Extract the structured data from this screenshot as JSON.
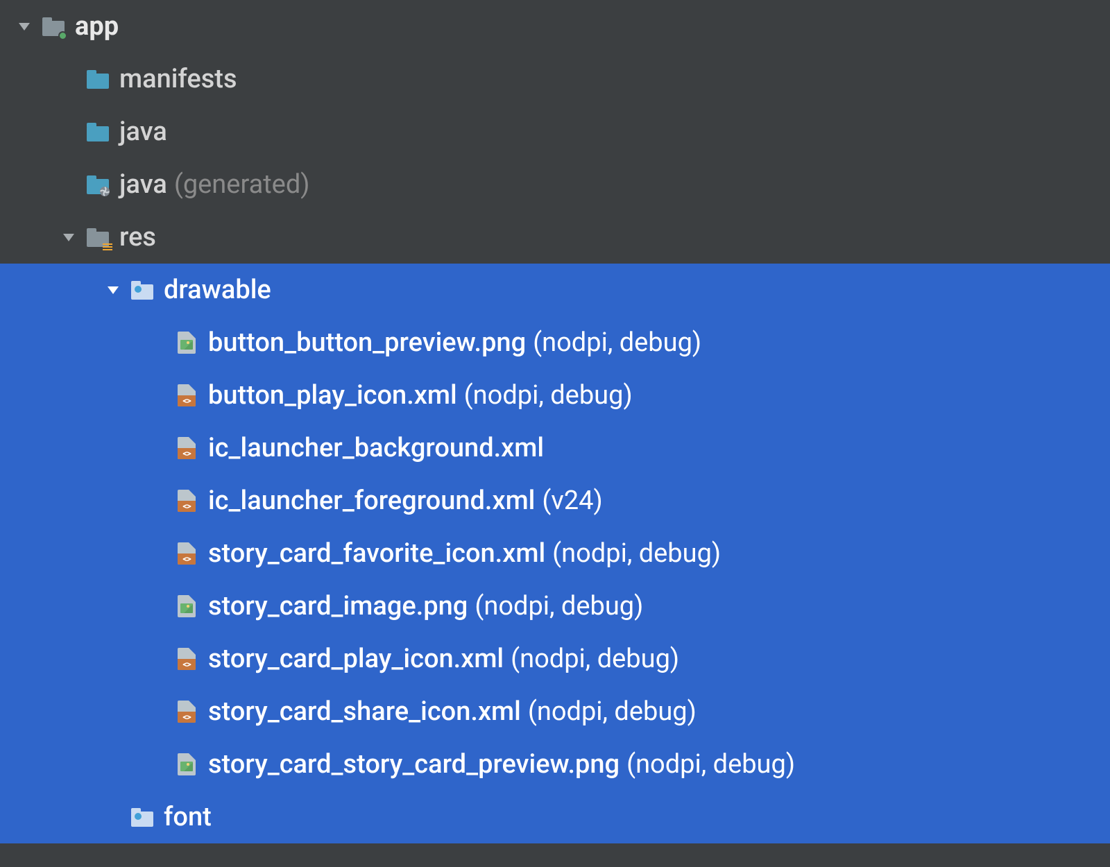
{
  "tree": {
    "root": {
      "name": "app",
      "expanded": true,
      "icon": "module-folder",
      "children": [
        {
          "name": "manifests",
          "expanded": false,
          "icon": "teal-folder"
        },
        {
          "name": "java",
          "expanded": false,
          "icon": "teal-folder"
        },
        {
          "name": "java",
          "qualifier": "(generated)",
          "expanded": false,
          "icon": "gen-folder"
        },
        {
          "name": "res",
          "expanded": true,
          "icon": "res-folder",
          "children": [
            {
              "name": "drawable",
              "expanded": true,
              "icon": "drawable-folder",
              "selected": true,
              "children": [
                {
                  "name": "button_button_preview.png",
                  "qualifier": "(nodpi, debug)",
                  "icon": "image-file",
                  "selected": true
                },
                {
                  "name": "button_play_icon.xml",
                  "qualifier": "(nodpi, debug)",
                  "icon": "xml-file",
                  "selected": true
                },
                {
                  "name": "ic_launcher_background.xml",
                  "icon": "xml-file",
                  "selected": true
                },
                {
                  "name": "ic_launcher_foreground.xml",
                  "qualifier": "(v24)",
                  "icon": "xml-file",
                  "selected": true
                },
                {
                  "name": "story_card_favorite_icon.xml",
                  "qualifier": "(nodpi, debug)",
                  "icon": "xml-file",
                  "selected": true
                },
                {
                  "name": "story_card_image.png",
                  "qualifier": "(nodpi, debug)",
                  "icon": "image-file",
                  "selected": true
                },
                {
                  "name": "story_card_play_icon.xml",
                  "qualifier": "(nodpi, debug)",
                  "icon": "xml-file",
                  "selected": true
                },
                {
                  "name": "story_card_share_icon.xml",
                  "qualifier": "(nodpi, debug)",
                  "icon": "xml-file",
                  "selected": true
                },
                {
                  "name": "story_card_story_card_preview.png",
                  "qualifier": "(nodpi, debug)",
                  "icon": "image-file",
                  "selected": true
                }
              ]
            },
            {
              "name": "font",
              "icon": "drawable-folder",
              "selected": true
            }
          ]
        }
      ]
    }
  }
}
